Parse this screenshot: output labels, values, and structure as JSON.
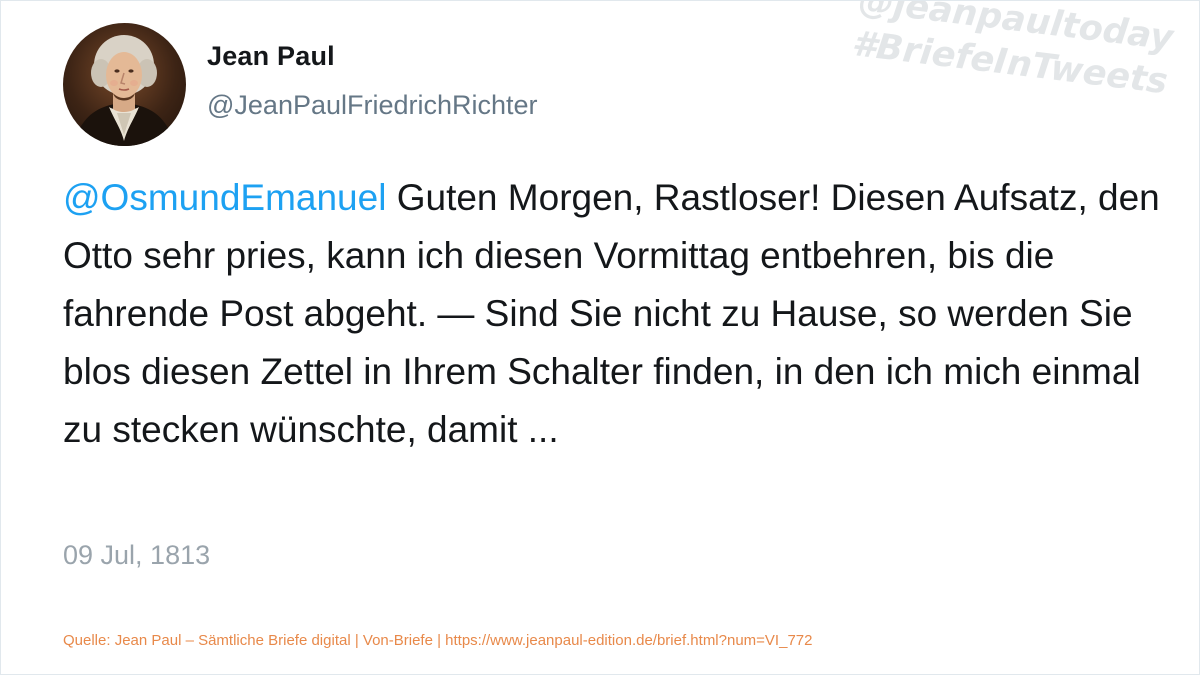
{
  "author": {
    "display_name": "Jean Paul",
    "handle": "@JeanPaulFriedrichRichter",
    "avatar_icon": "portrait-avatar"
  },
  "watermark": {
    "line1": "@jeanpaultoday",
    "line2": "#BriefeInTweets"
  },
  "tweet": {
    "mention": "@OsmundEmanuel",
    "text": " Guten Morgen, Rastloser! Diesen Aufsatz, den Otto sehr pries, kann ich diesen Vormittag entbehren, bis die fahrende Post abgeht. — Sind Sie nicht zu Hause, so werden Sie blos diesen Zettel in Ihrem Schalter finden, in den ich mich einmal zu stecken wünschte, damit ...",
    "date": "09 Jul, 1813"
  },
  "source": "Quelle: Jean Paul – Sämtliche Briefe digital | Von-Briefe | https://www.jeanpaul-edition.de/brief.html?num=VI_772",
  "colors": {
    "mention": "#1da1f2",
    "text": "#14171a",
    "muted": "#657786",
    "source": "#e8894a",
    "watermark": "#e3e6e8"
  }
}
